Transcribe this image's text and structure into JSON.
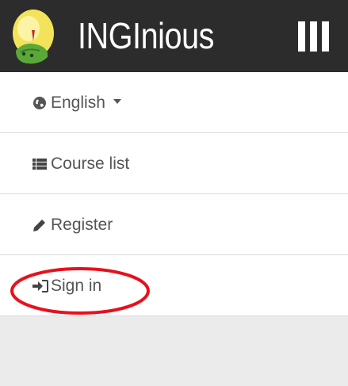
{
  "navbar": {
    "brand": "INGInious",
    "logo_icon": "inginious-logo-icon",
    "toggle_icon": "menu-toggle-icon",
    "background": "#2c2c2c"
  },
  "menu": {
    "language": {
      "label": "English",
      "icon": "globe-icon"
    },
    "course_list": {
      "label": "Course list",
      "icon": "list-icon"
    },
    "register": {
      "label": "Register",
      "icon": "pencil-icon"
    },
    "sign_in": {
      "label": "Sign in",
      "icon": "sign-in-icon"
    }
  },
  "annotation": {
    "color": "#e8101c",
    "target": "sign-in"
  }
}
